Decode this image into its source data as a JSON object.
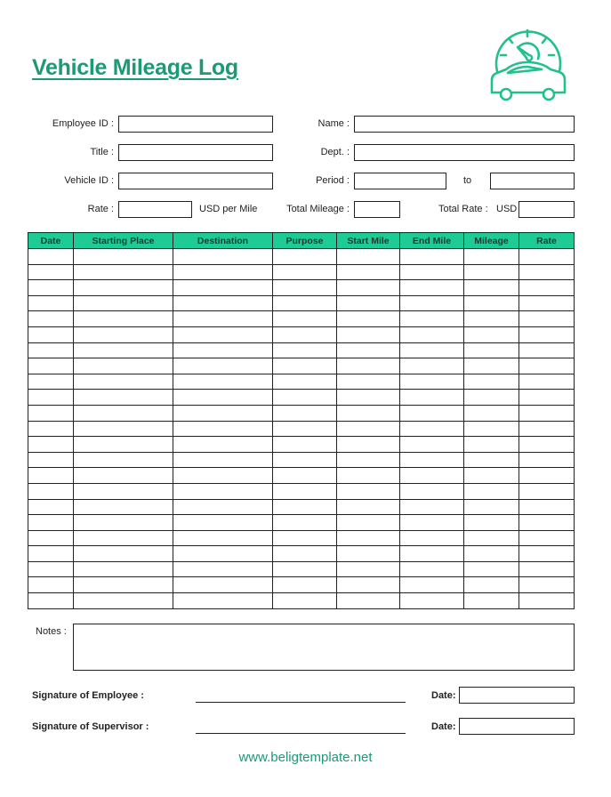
{
  "header": {
    "title": "Vehicle Mileage Log",
    "logo_icon": "car-speedometer-icon",
    "accent_color": "#1b9a76",
    "table_header_color": "#1ecb95"
  },
  "form": {
    "employee_id": {
      "label": "Employee ID :",
      "value": ""
    },
    "name": {
      "label": "Name :",
      "value": ""
    },
    "title": {
      "label": "Title :",
      "value": ""
    },
    "dept": {
      "label": "Dept. :",
      "value": ""
    },
    "vehicle_id": {
      "label": "Vehicle ID :",
      "value": ""
    },
    "period": {
      "label": "Period :",
      "from_value": "",
      "to_label": "to",
      "to_value": ""
    },
    "rate": {
      "label": "Rate :",
      "value": "",
      "unit": "USD per Mile"
    },
    "total_mileage": {
      "label": "Total Mileage :",
      "value": ""
    },
    "total_rate": {
      "label": "Total Rate :",
      "currency": "USD",
      "value": ""
    }
  },
  "table": {
    "columns": [
      "Date",
      "Starting Place",
      "Destination",
      "Purpose",
      "Start Mile",
      "End Mile",
      "Mileage",
      "Rate"
    ],
    "row_count": 23
  },
  "notes": {
    "label": "Notes :",
    "value": ""
  },
  "signatures": {
    "employee": {
      "label": "Signature of Employee :",
      "date_label": "Date:",
      "date_value": ""
    },
    "supervisor": {
      "label": "Signature of Supervisor :",
      "date_label": "Date:",
      "date_value": ""
    }
  },
  "footer": {
    "website": "www.beligtemplate.net"
  }
}
